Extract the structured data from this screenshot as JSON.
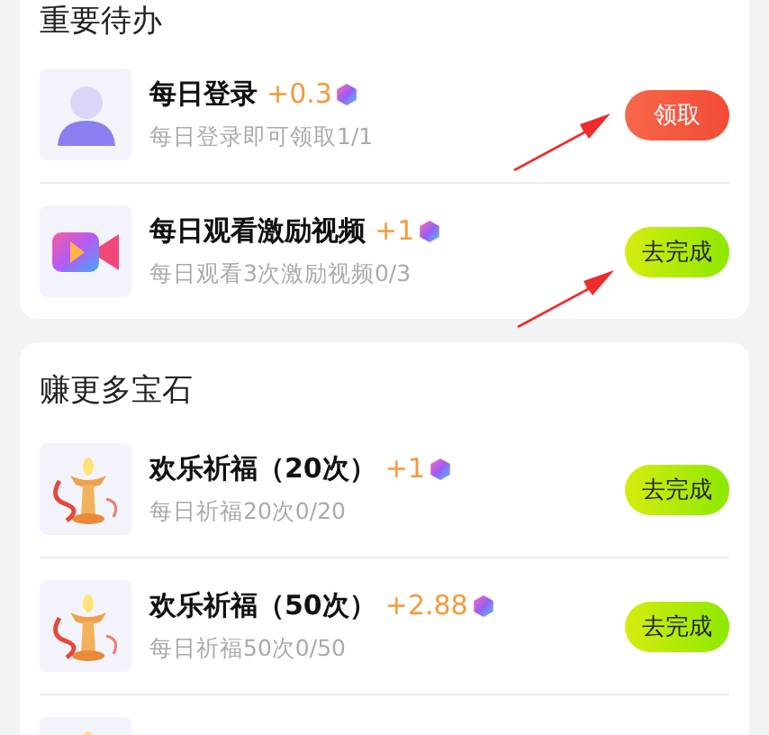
{
  "sections": [
    {
      "title": "重要待办",
      "tasks": [
        {
          "kind": "avatar",
          "name": "每日登录",
          "reward": "+0.3",
          "progress": "每日登录即可领取1/1",
          "button": {
            "label": "领取",
            "kind": "claim"
          }
        },
        {
          "kind": "video",
          "name": "每日观看激励视频",
          "reward": "+1",
          "progress": "每日观看3次激励视频0/3",
          "button": {
            "label": "去完成",
            "kind": "go"
          }
        }
      ]
    },
    {
      "title": "赚更多宝石",
      "tasks": [
        {
          "kind": "lamp",
          "name": "欢乐祈福（20次）",
          "reward": "+1",
          "progress": "每日祈福20次0/20",
          "button": {
            "label": "去完成",
            "kind": "go"
          }
        },
        {
          "kind": "lamp",
          "name": "欢乐祈福（50次）",
          "reward": "+2.88",
          "progress": "每日祈福50次0/50",
          "button": {
            "label": "去完成",
            "kind": "go"
          }
        },
        {
          "kind": "lamp"
        }
      ]
    }
  ],
  "annotations": [
    {
      "kind": "arrow"
    },
    {
      "kind": "arrow"
    }
  ]
}
